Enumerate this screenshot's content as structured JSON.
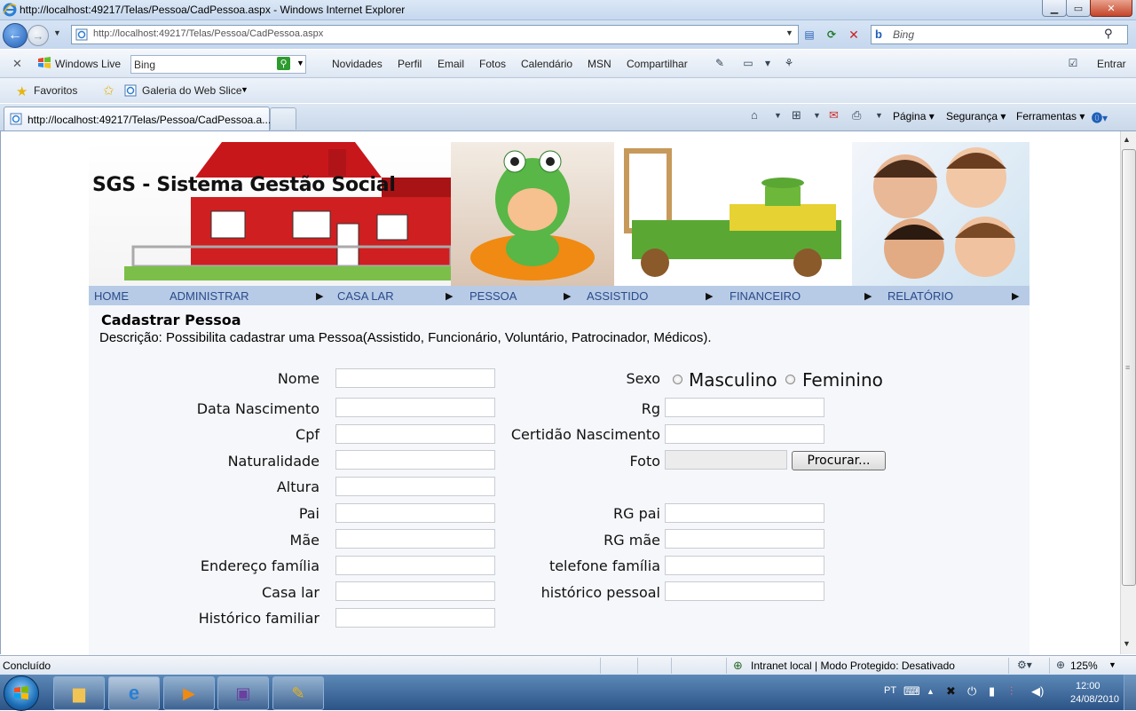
{
  "window": {
    "title": "http://localhost:49217/Telas/Pessoa/CadPessoa.aspx - Windows Internet Explorer"
  },
  "address_bar": {
    "url": "http://localhost:49217/Telas/Pessoa/CadPessoa.aspx",
    "search_placeholder": "Bing"
  },
  "live_toolbar": {
    "brand": "Windows Live",
    "search_value": "Bing",
    "links": [
      "Novidades",
      "Perfil",
      "Email",
      "Fotos",
      "Calendário",
      "MSN",
      "Compartilhar"
    ],
    "signin": "Entrar"
  },
  "favorites_bar": {
    "label": "Favoritos",
    "webslice": "Galeria do Web Slice"
  },
  "tabs": {
    "active_label": "http://localhost:49217/Telas/Pessoa/CadPessoa.a..."
  },
  "command_bar": {
    "pagina": "Página",
    "seguranca": "Segurança",
    "ferramentas": "Ferramentas"
  },
  "banner": {
    "title": "SGS - Sistema Gestão Social"
  },
  "menu": [
    "HOME",
    "ADMINISTRAR",
    "CASA LAR",
    "PESSOA",
    "ASSISTIDO",
    "FINANCEIRO",
    "RELATÓRIO"
  ],
  "page": {
    "heading": "Cadastrar Pessoa",
    "description": "Descrição: Possibilita cadastrar uma Pessoa(Assistido, Funcionário, Voluntário, Patrocinador, Médicos)."
  },
  "form": {
    "left_labels": [
      "Nome",
      "Data Nascimento",
      "Cpf",
      "Naturalidade",
      "Altura",
      "Pai",
      "Mãe",
      "Endereço família",
      "Casa lar",
      "Histórico familiar"
    ],
    "sexo_label": "Sexo",
    "sexo_options": [
      "Masculino",
      "Feminino"
    ],
    "right_labels": [
      "Rg",
      "Certidão Nascimento",
      "Foto",
      "RG pai",
      "RG mãe",
      "telefone família",
      "histórico pessoal"
    ],
    "browse_button": "Procurar..."
  },
  "status_bar": {
    "status": "Concluído",
    "zone": "Intranet local | Modo Protegido: Desativado",
    "zoom": "125%"
  },
  "taskbar": {
    "language": "PT",
    "time": "12:00",
    "date": "24/08/2010"
  }
}
